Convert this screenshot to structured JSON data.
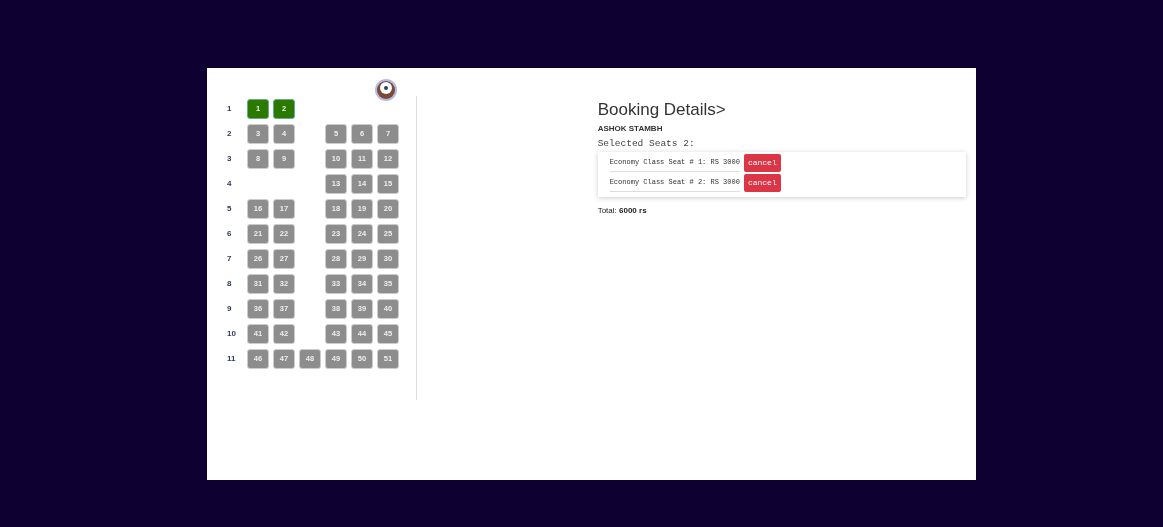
{
  "seat_map": {
    "rows": [
      {
        "label": "1",
        "left": [
          {
            "number": "1",
            "selected": true
          },
          {
            "number": "2",
            "selected": true
          }
        ],
        "middle": [],
        "right": []
      },
      {
        "label": "2",
        "left": [
          {
            "number": "3",
            "selected": false
          },
          {
            "number": "4",
            "selected": false
          }
        ],
        "middle": [],
        "right": [
          {
            "number": "5",
            "selected": false
          },
          {
            "number": "6",
            "selected": false
          },
          {
            "number": "7",
            "selected": false
          }
        ]
      },
      {
        "label": "3",
        "left": [
          {
            "number": "8",
            "selected": false
          },
          {
            "number": "9",
            "selected": false
          }
        ],
        "middle": [],
        "right": [
          {
            "number": "10",
            "selected": false
          },
          {
            "number": "11",
            "selected": false
          },
          {
            "number": "12",
            "selected": false
          }
        ]
      },
      {
        "label": "4",
        "left": [],
        "middle": [],
        "right": [
          {
            "number": "13",
            "selected": false
          },
          {
            "number": "14",
            "selected": false
          },
          {
            "number": "15",
            "selected": false
          }
        ]
      },
      {
        "label": "5",
        "left": [
          {
            "number": "16",
            "selected": false
          },
          {
            "number": "17",
            "selected": false
          }
        ],
        "middle": [],
        "right": [
          {
            "number": "18",
            "selected": false
          },
          {
            "number": "19",
            "selected": false
          },
          {
            "number": "20",
            "selected": false
          }
        ]
      },
      {
        "label": "6",
        "left": [
          {
            "number": "21",
            "selected": false
          },
          {
            "number": "22",
            "selected": false
          }
        ],
        "middle": [],
        "right": [
          {
            "number": "23",
            "selected": false
          },
          {
            "number": "24",
            "selected": false
          },
          {
            "number": "25",
            "selected": false
          }
        ]
      },
      {
        "label": "7",
        "left": [
          {
            "number": "26",
            "selected": false
          },
          {
            "number": "27",
            "selected": false
          }
        ],
        "middle": [],
        "right": [
          {
            "number": "28",
            "selected": false
          },
          {
            "number": "29",
            "selected": false
          },
          {
            "number": "30",
            "selected": false
          }
        ]
      },
      {
        "label": "8",
        "left": [
          {
            "number": "31",
            "selected": false
          },
          {
            "number": "32",
            "selected": false
          }
        ],
        "middle": [],
        "right": [
          {
            "number": "33",
            "selected": false
          },
          {
            "number": "34",
            "selected": false
          },
          {
            "number": "35",
            "selected": false
          }
        ]
      },
      {
        "label": "9",
        "left": [
          {
            "number": "36",
            "selected": false
          },
          {
            "number": "37",
            "selected": false
          }
        ],
        "middle": [],
        "right": [
          {
            "number": "38",
            "selected": false
          },
          {
            "number": "39",
            "selected": false
          },
          {
            "number": "40",
            "selected": false
          }
        ]
      },
      {
        "label": "10",
        "left": [
          {
            "number": "41",
            "selected": false
          },
          {
            "number": "42",
            "selected": false
          }
        ],
        "middle": [],
        "right": [
          {
            "number": "43",
            "selected": false
          },
          {
            "number": "44",
            "selected": false
          },
          {
            "number": "45",
            "selected": false
          }
        ]
      },
      {
        "label": "11",
        "left": [
          {
            "number": "46",
            "selected": false
          },
          {
            "number": "47",
            "selected": false
          }
        ],
        "middle": [
          {
            "number": "48",
            "selected": false
          }
        ],
        "right": [
          {
            "number": "49",
            "selected": false
          },
          {
            "number": "50",
            "selected": false
          },
          {
            "number": "51",
            "selected": false
          }
        ]
      }
    ]
  },
  "booking": {
    "title": "Booking Details>",
    "passenger": "ASHOK STAMBH",
    "selected_label": "Selected Seats 2:",
    "items": [
      {
        "text": "Economy Class Seat # 1: RS 3000",
        "button": "cancel"
      },
      {
        "text": "Economy Class Seat # 2: RS 3000",
        "button": "cancel"
      }
    ],
    "total": "Total: **6000 rs**"
  }
}
